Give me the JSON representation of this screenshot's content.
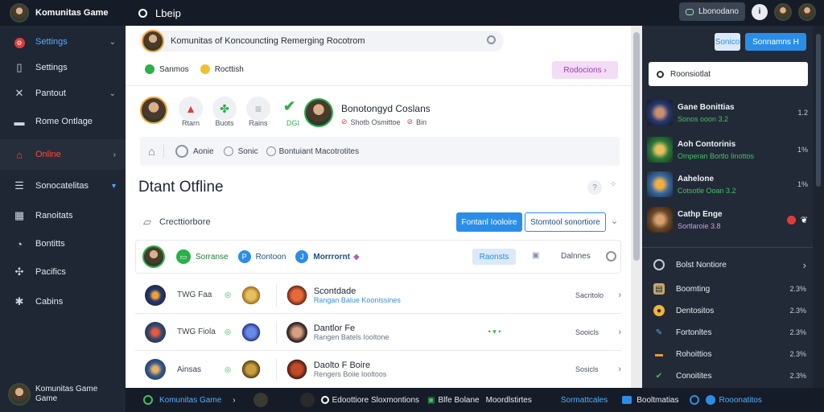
{
  "topbar": {
    "brand": "Komunitas Game",
    "search_text": "Lbeip",
    "button_label": "Lbonodano",
    "profile_initial": "i"
  },
  "sidebar": {
    "items": [
      {
        "label": "Settings",
        "icon": "gear-icon",
        "state": "highlight-red",
        "chevron": "⌄"
      },
      {
        "label": "Settings",
        "icon": "bookmark-icon",
        "state": "normal",
        "chevron": ""
      },
      {
        "label": "Pantout",
        "icon": "sword-icon",
        "state": "normal",
        "chevron": "⌄"
      },
      {
        "label": "Rome Ontlage",
        "icon": "folder-icon",
        "state": "normal",
        "chevron": ""
      },
      {
        "label": "Online",
        "icon": "home-icon",
        "state": "active",
        "chevron": "›"
      },
      {
        "label": "Sonocatelitas",
        "icon": "list-icon",
        "state": "highlight-blue",
        "chevron": "▾"
      },
      {
        "label": "Ranoitats",
        "icon": "chart-icon",
        "state": "normal",
        "chevron": ""
      },
      {
        "label": "Bontitts",
        "icon": "chat-icon",
        "state": "normal",
        "chevron": ""
      },
      {
        "label": "Pacifics",
        "icon": "puzzle-icon",
        "state": "normal",
        "chevron": ""
      },
      {
        "label": "Cabins",
        "icon": "star-icon",
        "state": "normal",
        "chevron": ""
      }
    ],
    "user": {
      "name": "Komunitas Game",
      "sub": "Game"
    }
  },
  "header": {
    "search_text": "Komunitas of Koncouncting Remerging Rocotrom",
    "tag1": "Sanmos",
    "tag2": "Rocttish",
    "badge_label": "Rodocions ›"
  },
  "activity": {
    "tiles": [
      {
        "icon": "fire-icon",
        "glyph": "▲",
        "label": "Rtarn",
        "color": "#e03b3b"
      },
      {
        "icon": "leaf-icon",
        "glyph": "✤",
        "label": "Buots",
        "color": "#2bb04a"
      },
      {
        "icon": "bar-icon",
        "glyph": "≡",
        "label": "Rains",
        "color": "#98a0ab"
      }
    ],
    "check_label": "DGI",
    "name": "Bonotongyd Coslans",
    "meta1": "Shotb Osmittoe",
    "meta2": "Bin"
  },
  "filters": {
    "label1": "Aonie",
    "label2": "Sonic",
    "label3": "Bontuiant Macotrotites"
  },
  "section": {
    "title": "Dtant Otfline",
    "sub_label": "Crecttiorbore",
    "btn_primary": "Fontanl Iooloire",
    "btn_outline": "Stomtool sonortiore"
  },
  "online_row": {
    "chip1": "Sorranse",
    "chip2": "Rontoon",
    "chip3": "Morrrornt",
    "pill": "Raonsts",
    "right_label": "Dalnnes"
  },
  "games": [
    {
      "tag": "TWG Faa",
      "name": "Scontdade",
      "sub": "Rangan Balue Koonissines",
      "stat": "Sacritolo",
      "mid": ""
    },
    {
      "tag": "TWG Fiola",
      "name": "Dantlor Fe",
      "sub": "Rangen Batels Iooltone",
      "stat": "Sooicls",
      "mid": "• ▾ •"
    },
    {
      "tag": "Ainsas",
      "name": "Daolto F Boire",
      "sub": "Rengers Boiie Iooltoos",
      "stat": "Sosicls",
      "mid": ""
    }
  ],
  "right_panel": {
    "search_text": "Roonsiotlat",
    "tab1": "Sonico",
    "tab2": "Sonnamns H",
    "games": [
      {
        "name": "Gane Bonittias",
        "sub": "Sonos ooon 3.2",
        "value": "1.2"
      },
      {
        "name": "Aoh Contorinis",
        "sub": "Omperan Bortlo Iinottos",
        "value": "1%"
      },
      {
        "name": "Aahelone",
        "sub": "Cotsotle Ooan 3.2",
        "value": "1%"
      },
      {
        "name": "Cathp Enge",
        "sub": "Sortlaroie 3.8",
        "value": ""
      }
    ],
    "section_title": "Bolst Nontiore",
    "stats": [
      {
        "label": "Boomting",
        "value": "2.3%",
        "color": "#c8a76a",
        "glyph": "▤"
      },
      {
        "label": "Dentositos",
        "value": "2.3%",
        "color": "#f0b43a",
        "glyph": "●"
      },
      {
        "label": "Fortonltes",
        "value": "2.3%",
        "color": "#3ab7e8",
        "glyph": "✎"
      },
      {
        "label": "Rohoittios",
        "value": "2.3%",
        "color": "#e89a3a",
        "glyph": "▬"
      },
      {
        "label": "Conoitites",
        "value": "2.3%",
        "color": "#41c265",
        "glyph": "✔"
      }
    ]
  },
  "bottombar": {
    "left": "Komunitas Game",
    "mid1": "Edoottiore Sloxmontions",
    "mid2": "Blfe Bolane",
    "mid3": "Moordlstirtes",
    "blue": "Sormattcales",
    "r1": "Booltmatias",
    "r2": "Rooonatitos"
  },
  "colors": {
    "accent_blue": "#2a8ee8",
    "accent_red": "#ff4a3a",
    "accent_green": "#41c265",
    "dark_bg": "#1f2735"
  }
}
